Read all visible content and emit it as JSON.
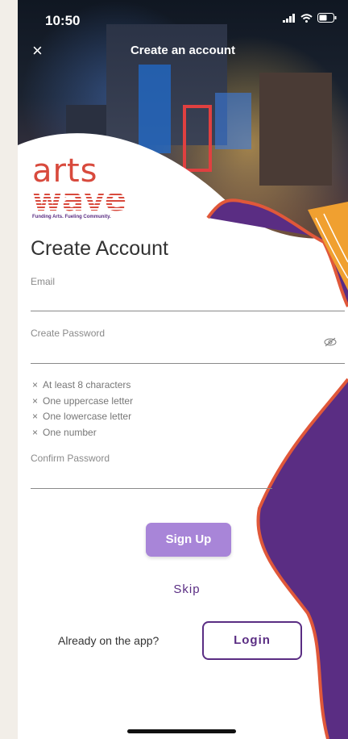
{
  "status_bar": {
    "time": "10:50"
  },
  "header": {
    "title": "Create an account",
    "close_icon": "×"
  },
  "logo": {
    "line1": "arts",
    "line2": "wave",
    "tagline": "Funding Arts. Fueling Community."
  },
  "form": {
    "heading": "Create Account",
    "email": {
      "label": "Email",
      "value": ""
    },
    "password": {
      "label": "Create Password",
      "value": ""
    },
    "rules": [
      {
        "mark": "×",
        "text": "At least 8 characters"
      },
      {
        "mark": "×",
        "text": "One uppercase letter"
      },
      {
        "mark": "×",
        "text": "One lowercase letter"
      },
      {
        "mark": "×",
        "text": "One number"
      }
    ],
    "confirm": {
      "label": "Confirm Password",
      "value": ""
    }
  },
  "actions": {
    "signup_label": "Sign Up",
    "skip_label": "Skip",
    "already_text": "Already on the app?",
    "login_label": "Login"
  },
  "colors": {
    "accent_purple": "#5a2d83",
    "button_purple": "#a885d8",
    "brand_red": "#d84a3d",
    "deco_orange": "#e0583a"
  }
}
